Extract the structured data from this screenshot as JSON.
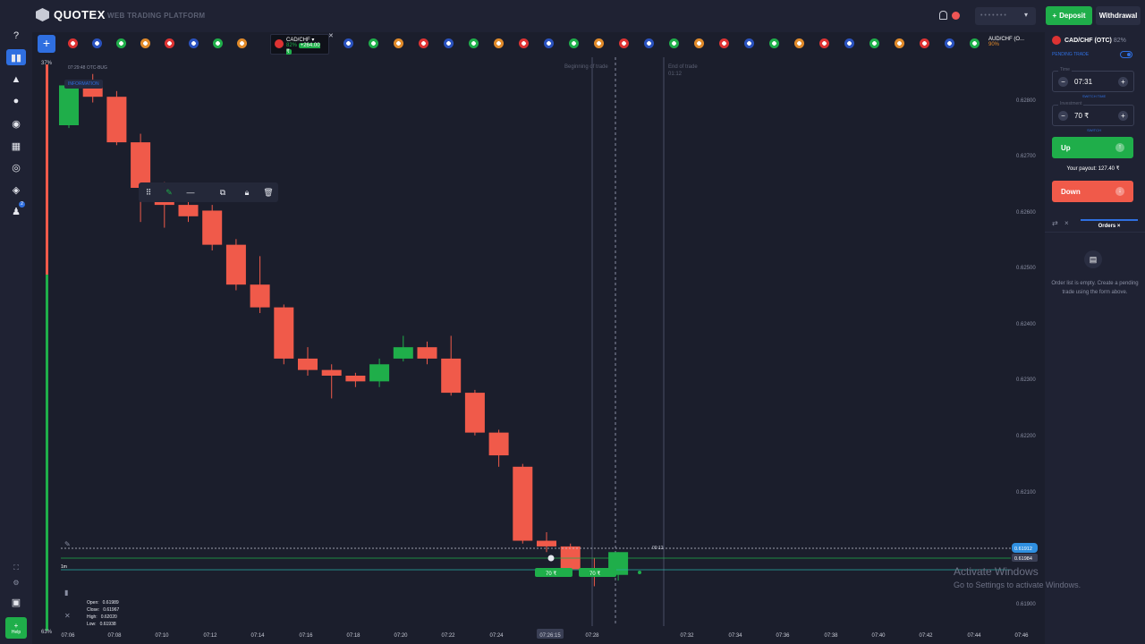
{
  "brand": {
    "name": "QUOTEX",
    "subtitle": "WEB TRADING PLATFORM"
  },
  "header": {
    "account_masked": "• • • • • • •",
    "deposit_label": "Deposit",
    "withdrawal_label": "Withdrawal"
  },
  "nav": {
    "help_label": "Help",
    "notifications_badge": "2"
  },
  "asset_strip": {
    "active": {
      "name": "CAD/CHF",
      "payout": "82%",
      "profit": "+264.00 ₹"
    },
    "end_asset": {
      "name": "AUD/CHF (O...",
      "payout": "90%"
    }
  },
  "chart_info": {
    "pair_line": "07:29:48  OTC-BUG",
    "info_link": "INFORMATION",
    "pct_top": "37%",
    "pct_bottom": "63%",
    "beginning_label": "Beginning of trade",
    "end_label": "End of trade",
    "end_time": "01:12",
    "timeframe": "1m",
    "ohlc": {
      "open_label": "Open:",
      "open": "0.61989",
      "close_label": "Close:",
      "close": "0.61967",
      "high_label": "High:",
      "high": "0.62020",
      "low_label": "Low:",
      "low": "0.61938"
    },
    "current_price": "0.61912",
    "line_price": "0.61984",
    "timer": "00:12",
    "orders_on_chart": [
      "70 ₹",
      "70 ₹"
    ],
    "cursor_time": "07:26:15"
  },
  "sidebar": {
    "asset": "CAD/CHF (OTC)",
    "payout": "82%",
    "pending_trade": "PENDING TRADE",
    "time_label": "Time",
    "time_value": "07:31",
    "switch_time": "SWITCH TIME",
    "investment_label": "Investment",
    "investment_value": "70 ₹",
    "switch": "SWITCH",
    "up_label": "Up",
    "payout_text": "Your payout: 127.40 ₹",
    "down_label": "Down",
    "orders_tab": "Orders",
    "empty_text": "Order list is empty. Create a pending trade using the form above."
  },
  "watermark": {
    "title": "Activate Windows",
    "subtitle": "Go to Settings to activate Windows."
  },
  "chart_data": {
    "type": "candlestick",
    "timeframe": "1m",
    "price_ticks": [
      "0.62800",
      "0.62700",
      "0.62600",
      "0.62500",
      "0.62400",
      "0.62300",
      "0.62200",
      "0.62100",
      "0.61900"
    ],
    "time_ticks": [
      "07:06",
      "07:08",
      "07:10",
      "07:12",
      "07:14",
      "07:16",
      "07:18",
      "07:20",
      "07:22",
      "07:24",
      "07:26:15",
      "07:28",
      "07:32",
      "07:34",
      "07:36",
      "07:38",
      "07:40",
      "07:42",
      "07:44",
      "07:46"
    ],
    "ylim": [
      0.6188,
      0.6287
    ],
    "up_color": "#1fae4a",
    "down_color": "#f05a4a",
    "candles": [
      {
        "t": "07:06",
        "o": 0.6276,
        "c": 0.6283,
        "h": 0.6284,
        "l": 0.62755
      },
      {
        "t": "07:07",
        "o": 0.6283,
        "c": 0.6281,
        "h": 0.6285,
        "l": 0.628
      },
      {
        "t": "07:08",
        "o": 0.6281,
        "c": 0.6273,
        "h": 0.6282,
        "l": 0.62725
      },
      {
        "t": "07:09",
        "o": 0.6273,
        "c": 0.6265,
        "h": 0.62745,
        "l": 0.6259
      },
      {
        "t": "07:10",
        "o": 0.6265,
        "c": 0.6262,
        "h": 0.6266,
        "l": 0.6258
      },
      {
        "t": "07:11",
        "o": 0.6262,
        "c": 0.626,
        "h": 0.6264,
        "l": 0.6259
      },
      {
        "t": "07:12",
        "o": 0.6261,
        "c": 0.6255,
        "h": 0.6262,
        "l": 0.6254
      },
      {
        "t": "07:13",
        "o": 0.6255,
        "c": 0.6248,
        "h": 0.6256,
        "l": 0.6247
      },
      {
        "t": "07:14",
        "o": 0.6248,
        "c": 0.6244,
        "h": 0.6253,
        "l": 0.6243
      },
      {
        "t": "07:15",
        "o": 0.6244,
        "c": 0.6235,
        "h": 0.62445,
        "l": 0.6234
      },
      {
        "t": "07:16",
        "o": 0.6235,
        "c": 0.6233,
        "h": 0.6237,
        "l": 0.6232
      },
      {
        "t": "07:17",
        "o": 0.6233,
        "c": 0.6232,
        "h": 0.6234,
        "l": 0.6228
      },
      {
        "t": "07:18",
        "o": 0.6232,
        "c": 0.6231,
        "h": 0.62325,
        "l": 0.623
      },
      {
        "t": "07:19",
        "o": 0.6231,
        "c": 0.6234,
        "h": 0.6235,
        "l": 0.623
      },
      {
        "t": "07:20",
        "o": 0.6235,
        "c": 0.6237,
        "h": 0.6239,
        "l": 0.62345
      },
      {
        "t": "07:21",
        "o": 0.6237,
        "c": 0.6235,
        "h": 0.6238,
        "l": 0.6234
      },
      {
        "t": "07:22",
        "o": 0.6235,
        "c": 0.6229,
        "h": 0.6239,
        "l": 0.62285
      },
      {
        "t": "07:23",
        "o": 0.6229,
        "c": 0.6222,
        "h": 0.62295,
        "l": 0.62215
      },
      {
        "t": "07:24",
        "o": 0.6222,
        "c": 0.6218,
        "h": 0.62225,
        "l": 0.6216
      },
      {
        "t": "07:25",
        "o": 0.6216,
        "c": 0.6203,
        "h": 0.62165,
        "l": 0.62025
      },
      {
        "t": "07:26",
        "o": 0.6203,
        "c": 0.6202,
        "h": 0.62045,
        "l": 0.6201
      },
      {
        "t": "07:27",
        "o": 0.6202,
        "c": 0.6198,
        "h": 0.62025,
        "l": 0.61975
      },
      {
        "t": "07:28",
        "o": 0.6198,
        "c": 0.6197,
        "h": 0.62,
        "l": 0.6195
      },
      {
        "t": "07:29",
        "o": 0.6197,
        "c": 0.6201,
        "h": 0.6201,
        "l": 0.6196
      }
    ]
  }
}
